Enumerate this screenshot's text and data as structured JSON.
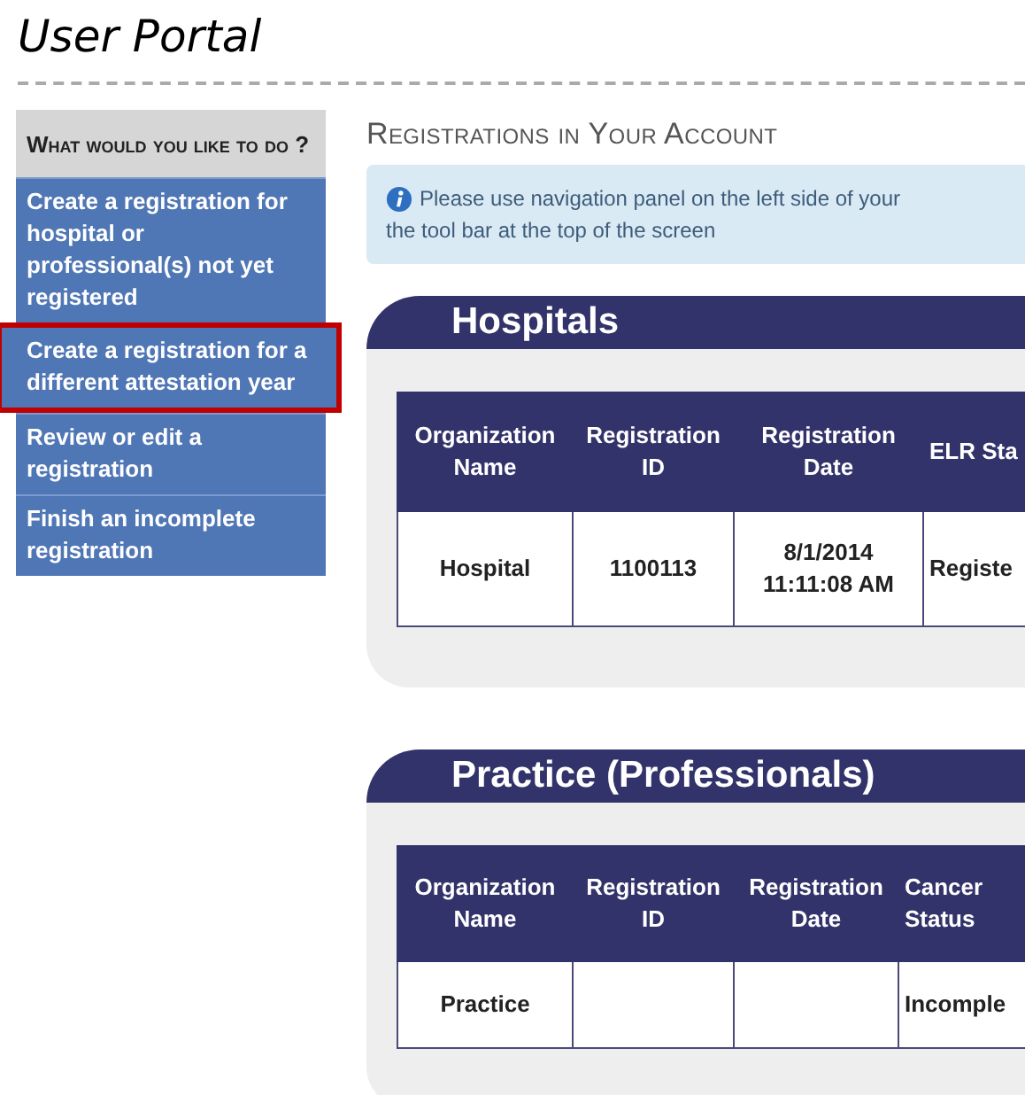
{
  "page_title": "User Portal",
  "sidebar": {
    "heading": "What would you like to do ?",
    "items": [
      {
        "label": "Create a registration for hospital or professional(s) not yet registered",
        "highlighted": false
      },
      {
        "label": "Create a registration for a different attestation year",
        "highlighted": true
      },
      {
        "label": "Review or edit a registration",
        "highlighted": false
      },
      {
        "label": "Finish an incomplete registration",
        "highlighted": false
      }
    ]
  },
  "main": {
    "heading": "Registrations in Your Account",
    "notice": [
      "Please use navigation panel on the left side of your",
      "the tool bar at the top of the screen"
    ],
    "panels": [
      {
        "title": "Hospitals",
        "columns": [
          "Organization Name",
          "Registration ID",
          "Registration Date",
          "ELR Sta"
        ],
        "rows": [
          [
            "Hospital",
            "1100113",
            "8/1/2014 11:11:08 AM",
            "Registe"
          ]
        ]
      },
      {
        "title": "Practice (Professionals)",
        "columns": [
          "Organization Name",
          "Registration ID",
          "Registration Date",
          "Cancer Status"
        ],
        "rows": [
          [
            "Practice",
            "",
            "",
            "Incomple"
          ]
        ]
      }
    ]
  }
}
